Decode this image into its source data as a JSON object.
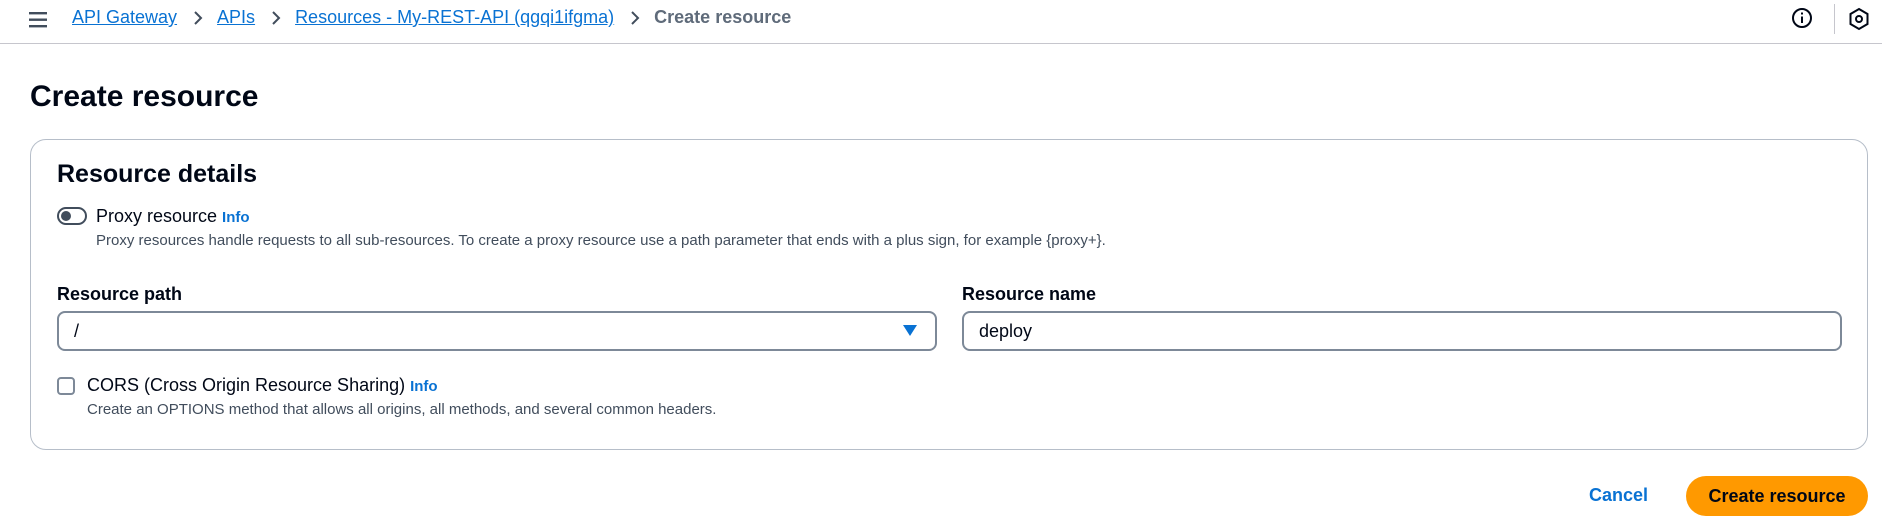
{
  "header": {
    "menu_icon": "hamburger-menu-icon",
    "breadcrumbs": [
      {
        "label": "API Gateway"
      },
      {
        "label": "APIs"
      },
      {
        "label": "Resources - My-REST-API (qgqi1ifgma)"
      },
      {
        "label": "Create resource"
      }
    ],
    "right_icons": [
      "info-circle-icon",
      "settings-hexagon-icon"
    ]
  },
  "page": {
    "title": "Create resource"
  },
  "resource_details": {
    "title": "Resource details",
    "proxy": {
      "label": "Proxy resource",
      "info": "Info",
      "enabled": false,
      "description": "Proxy resources handle requests to all sub-resources. To create a proxy resource use a path parameter that ends with a plus sign, for example {proxy+}."
    },
    "resource_path": {
      "label": "Resource path",
      "value": "/"
    },
    "resource_name": {
      "label": "Resource name",
      "value": "deploy"
    },
    "cors": {
      "label": "CORS (Cross Origin Resource Sharing)",
      "info": "Info",
      "checked": false,
      "description": "Create an OPTIONS method that allows all origins, all methods, and several common headers."
    }
  },
  "actions": {
    "cancel_label": "Cancel",
    "create_label": "Create resource"
  },
  "colors": {
    "link": "#0972d3",
    "primary_button": "#ff9900",
    "text": "#000716",
    "muted_text": "#414d5c",
    "border": "#7d8998"
  }
}
